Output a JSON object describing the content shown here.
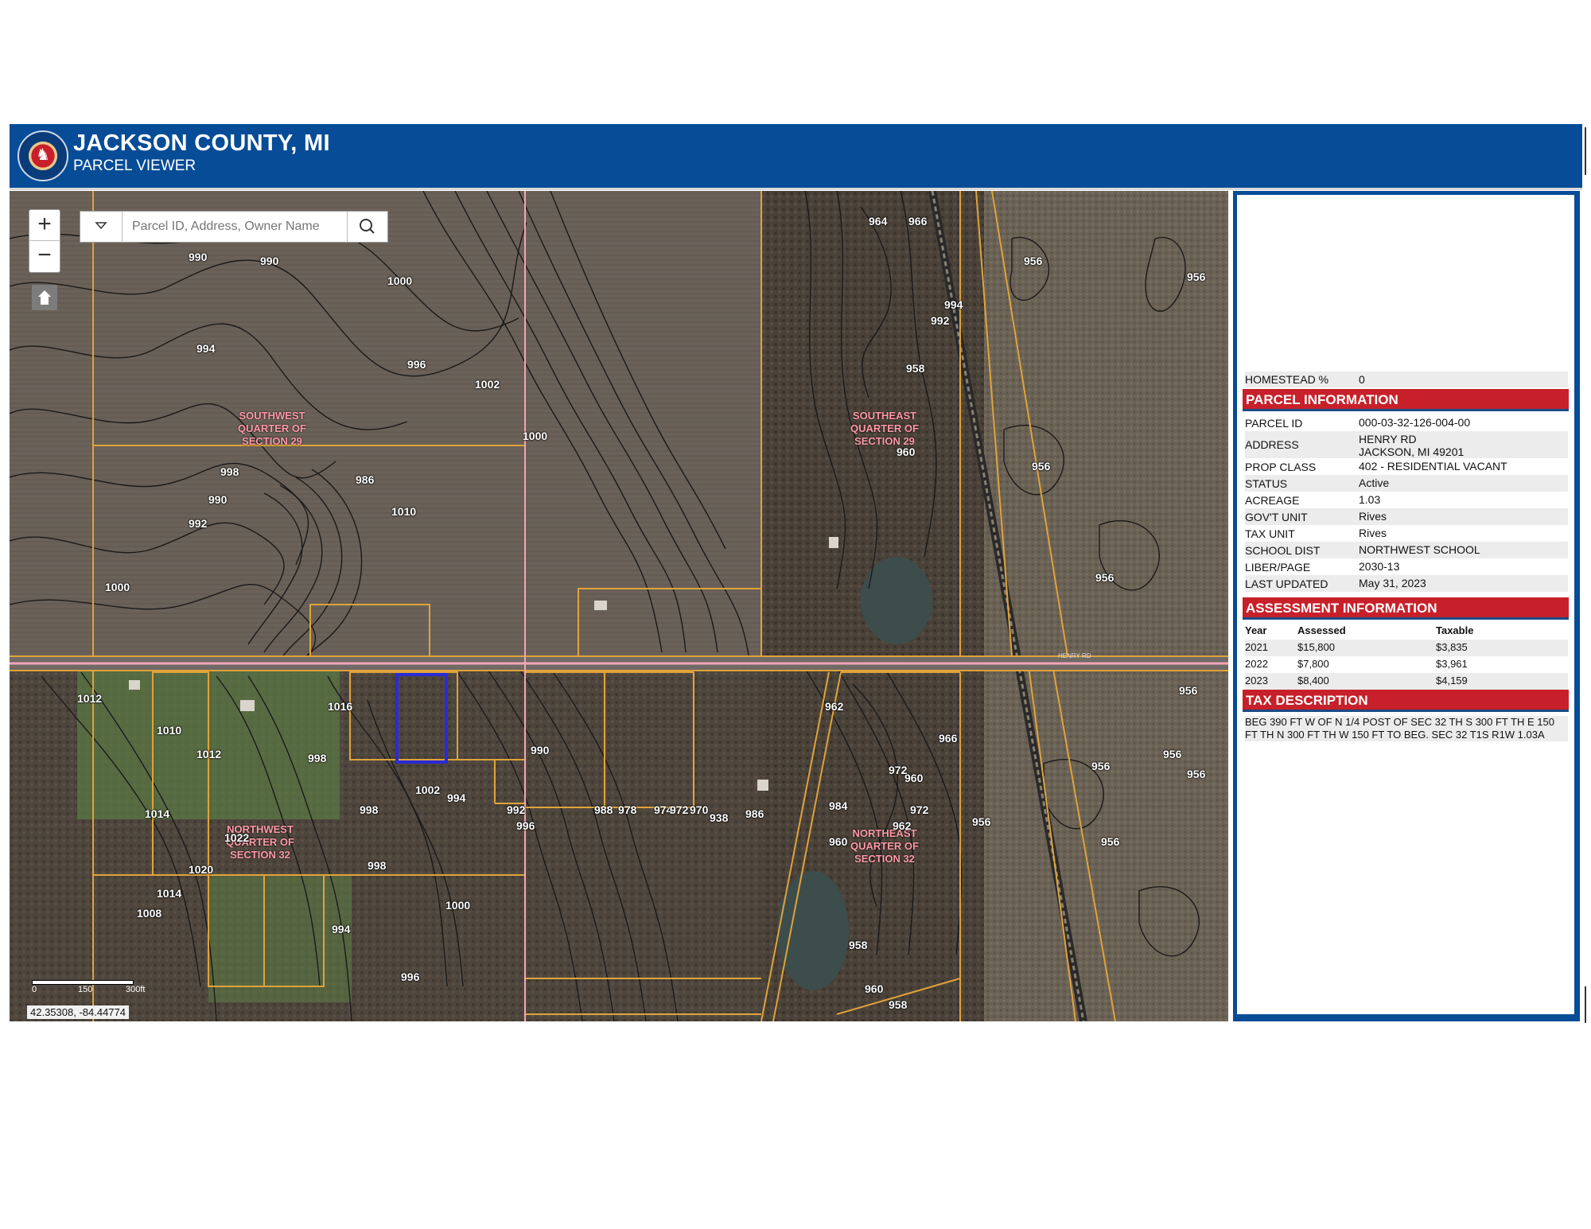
{
  "header": {
    "title": "JACKSON COUNTY, MI",
    "subtitle": "PARCEL VIEWER",
    "logo_icon": "county-seal-horse"
  },
  "map": {
    "search_placeholder": "Parcel ID, Address, Owner Name",
    "zoom_in": "+",
    "zoom_out": "−",
    "scale": {
      "l0": "0",
      "l1": "150",
      "l2": "300ft"
    },
    "coords": "42.35308, -84.44774",
    "road_label": "HENRY RD",
    "section_labels": [
      "SOUTHWEST QUARTER OF SECTION 29",
      "SOUTHEAST QUARTER OF SECTION 29",
      "NORTHWEST QUARTER OF SECTION 32",
      "NORTHEAST QUARTER OF SECTION 32"
    ],
    "contour_labels": [
      "990",
      "990",
      "1000",
      "994",
      "996",
      "1002",
      "1000",
      "998",
      "986",
      "1010",
      "990",
      "992",
      "1000",
      "964",
      "956",
      "966",
      "956",
      "992",
      "994",
      "958",
      "960",
      "956",
      "956",
      "956",
      "1012",
      "1010",
      "1016",
      "1012",
      "998",
      "998",
      "1002",
      "994",
      "992",
      "996",
      "990",
      "988",
      "978",
      "974",
      "972",
      "970",
      "938",
      "986",
      "962",
      "984",
      "960",
      "966",
      "972",
      "962",
      "972",
      "960",
      "956",
      "956",
      "956",
      "1014",
      "1022",
      "1020",
      "1014",
      "1008",
      "998",
      "994",
      "1000",
      "996",
      "958",
      "960",
      "958",
      "956",
      "956"
    ],
    "colors": {
      "parcel_line": "#e0a33a",
      "road": "#f2a5b5",
      "selected_parcel": "#2b2bd6",
      "contour": "#1a1a1a",
      "label": "#ff9aa8"
    }
  },
  "panel": {
    "homestead": {
      "label": "HOMESTEAD %",
      "value": "0"
    },
    "parcel_info_title": "PARCEL INFORMATION",
    "parcel_rows": [
      {
        "k": "PARCEL ID",
        "v": "000-03-32-126-004-00"
      },
      {
        "k": "ADDRESS",
        "v": "HENRY RD",
        "v2": "JACKSON, MI 49201"
      },
      {
        "k": "PROP CLASS",
        "v": "402 - RESIDENTIAL VACANT"
      },
      {
        "k": "STATUS",
        "v": "Active"
      },
      {
        "k": "ACREAGE",
        "v": "1.03"
      },
      {
        "k": "GOV'T UNIT",
        "v": "Rives"
      },
      {
        "k": "TAX UNIT",
        "v": "Rives"
      },
      {
        "k": "SCHOOL DIST",
        "v": "NORTHWEST SCHOOL"
      },
      {
        "k": "LIBER/PAGE",
        "v": "2030-13"
      },
      {
        "k": "LAST UPDATED",
        "v": "May 31, 2023"
      }
    ],
    "assessment_title": "ASSESSMENT INFORMATION",
    "assessment_headers": [
      "Year",
      "Assessed",
      "Taxable"
    ],
    "assessment_rows": [
      [
        "2021",
        "$15,800",
        "$3,835"
      ],
      [
        "2022",
        "$7,800",
        "$3,961"
      ],
      [
        "2023",
        "$8,400",
        "$4,159"
      ]
    ],
    "tax_title": "TAX DESCRIPTION",
    "tax_description": "BEG 390 FT W OF N 1/4 POST OF SEC 32 TH S 300 FT TH E 150 FT TH N 300 FT TH W 150 FT TO BEG. SEC 32 T1S R1W 1.03A"
  }
}
